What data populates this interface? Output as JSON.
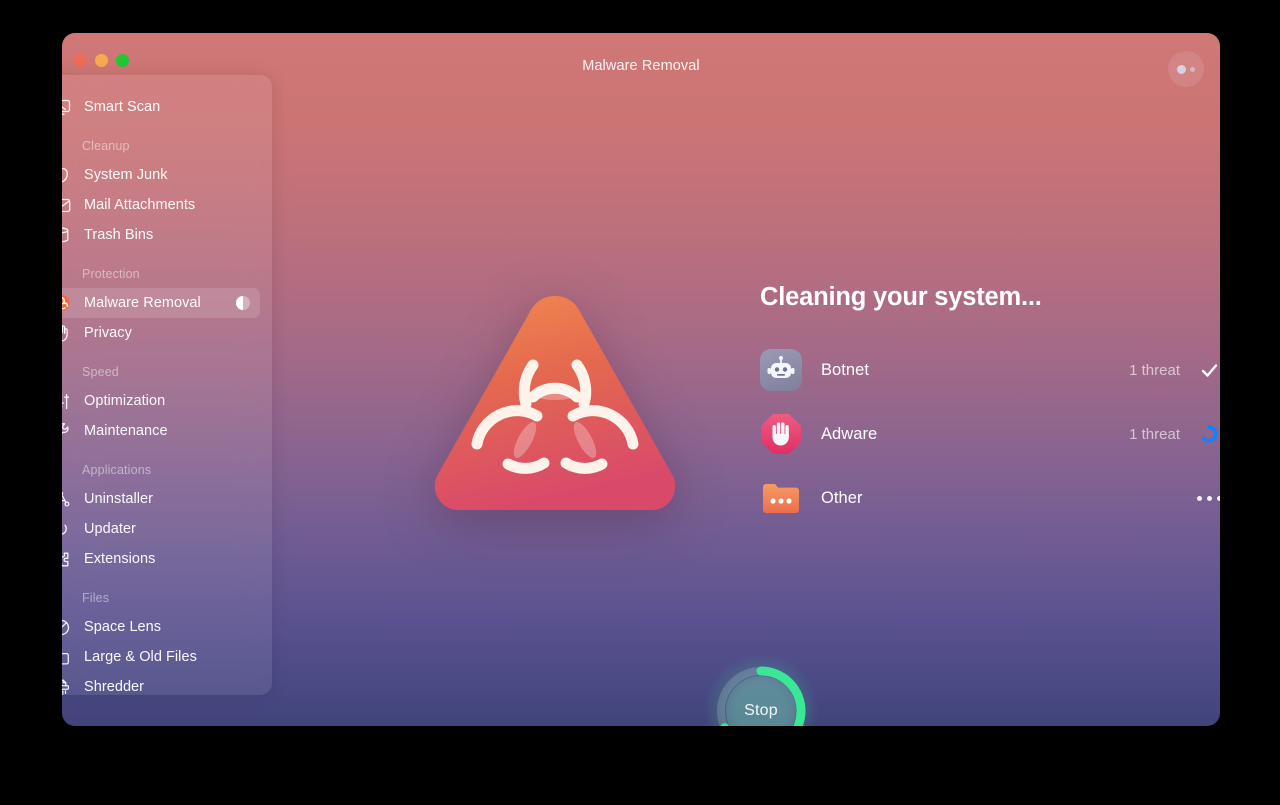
{
  "window": {
    "title": "Malware Removal",
    "traffic_lights": [
      {
        "name": "close",
        "color": "#ef6b55"
      },
      {
        "name": "minimize",
        "color": "#f9a94f"
      },
      {
        "name": "maximize",
        "color": "#23c631"
      }
    ],
    "account_button_icon": "account-dots-icon",
    "background_gradient_from": "#d07876",
    "background_gradient_to": "#414379"
  },
  "sidebar": {
    "top_item": {
      "label": "Smart Scan",
      "icon": "monitor-scan-icon"
    },
    "sections": [
      {
        "title": "Cleanup",
        "items": [
          {
            "label": "System Junk",
            "icon": "junk-icon"
          },
          {
            "label": "Mail Attachments",
            "icon": "envelope-icon"
          },
          {
            "label": "Trash Bins",
            "icon": "trash-bin-icon"
          }
        ]
      },
      {
        "title": "Protection",
        "items": [
          {
            "label": "Malware Removal",
            "icon": "biohazard-icon",
            "active": true,
            "badge": "half-circle-progress"
          },
          {
            "label": "Privacy",
            "icon": "hand-icon"
          }
        ]
      },
      {
        "title": "Speed",
        "items": [
          {
            "label": "Optimization",
            "icon": "sliders-icon"
          },
          {
            "label": "Maintenance",
            "icon": "wrench-icon"
          }
        ]
      },
      {
        "title": "Applications",
        "items": [
          {
            "label": "Uninstaller",
            "icon": "app-grid-icon"
          },
          {
            "label": "Updater",
            "icon": "refresh-arrow-icon"
          },
          {
            "label": "Extensions",
            "icon": "puzzle-piece-icon"
          }
        ]
      },
      {
        "title": "Files",
        "items": [
          {
            "label": "Space Lens",
            "icon": "space-lens-icon"
          },
          {
            "label": "Large & Old Files",
            "icon": "folder-icon"
          },
          {
            "label": "Shredder",
            "icon": "shredder-icon"
          }
        ]
      }
    ]
  },
  "main": {
    "hero_icon": "biohazard-triangle-icon",
    "heading": "Cleaning your system...",
    "threats": [
      {
        "name": "Botnet",
        "icon": "robot-icon",
        "count": "1 threat",
        "status": "check",
        "status_icon": "checkmark-icon",
        "icon_color": "#8c8da8"
      },
      {
        "name": "Adware",
        "icon": "stop-hand-icon",
        "count": "1 threat",
        "status": "loading",
        "status_icon": "spinner-icon",
        "icon_color": "#e8456f",
        "status_color": "#0a84ff"
      },
      {
        "name": "Other",
        "icon": "folder-dots-icon",
        "count": "",
        "status": "more",
        "status_icon": "ellipsis-icon",
        "icon_color": "#f4885a"
      }
    ],
    "stop_button": {
      "label": "Stop",
      "progress_percent": 68,
      "progress_color": "#3ae796"
    }
  }
}
